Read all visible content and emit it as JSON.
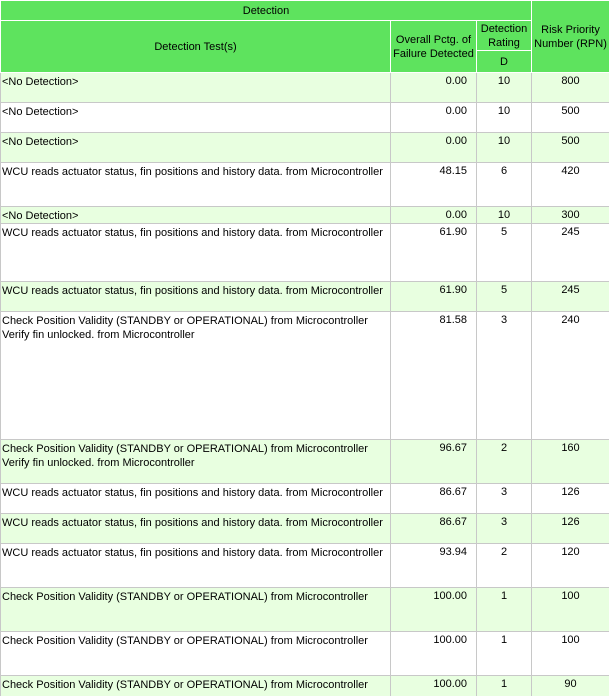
{
  "header": {
    "title": "Detection",
    "test_col": "Detection Test(s)",
    "pctg_col_line1": "Overall Pctg. of",
    "pctg_col_line2": "Failure Detected",
    "rating_col_line1": "Detection",
    "rating_col_line2": "Rating",
    "rating_sub": "D",
    "rpn_col_line1": "Risk Priority",
    "rpn_col_line2": "Number (RPN)"
  },
  "rows": [
    {
      "test": [
        "<No Detection>"
      ],
      "pctg": "0.00",
      "rating": "10",
      "rpn": "800"
    },
    {
      "test": [
        "<No Detection>"
      ],
      "pctg": "0.00",
      "rating": "10",
      "rpn": "500"
    },
    {
      "test": [
        "<No Detection>"
      ],
      "pctg": "0.00",
      "rating": "10",
      "rpn": "500"
    },
    {
      "test": [
        "WCU reads actuator status, fin positions and history data. from Microcontroller"
      ],
      "pctg": "48.15",
      "rating": "6",
      "rpn": "420"
    },
    {
      "test": [
        "<No Detection>"
      ],
      "pctg": "0.00",
      "rating": "10",
      "rpn": "300"
    },
    {
      "test": [
        "WCU reads actuator status, fin positions and history data. from Microcontroller"
      ],
      "pctg": "61.90",
      "rating": "5",
      "rpn": "245"
    },
    {
      "test": [
        "WCU reads actuator status, fin positions and history data. from Microcontroller"
      ],
      "pctg": "61.90",
      "rating": "5",
      "rpn": "245"
    },
    {
      "test": [
        "Check Position Validity (STANDBY or OPERATIONAL) from Microcontroller",
        "Verify fin unlocked. from Microcontroller"
      ],
      "pctg": "81.58",
      "rating": "3",
      "rpn": "240"
    },
    {
      "test": [
        "Check Position Validity (STANDBY or OPERATIONAL) from Microcontroller",
        "Verify fin unlocked. from Microcontroller"
      ],
      "pctg": "96.67",
      "rating": "2",
      "rpn": "160"
    },
    {
      "test": [
        "WCU reads actuator status, fin positions and history data. from Microcontroller"
      ],
      "pctg": "86.67",
      "rating": "3",
      "rpn": "126"
    },
    {
      "test": [
        "WCU reads actuator status, fin positions and history data. from Microcontroller"
      ],
      "pctg": "86.67",
      "rating": "3",
      "rpn": "126"
    },
    {
      "test": [
        "WCU reads actuator status, fin positions and history data. from Microcontroller"
      ],
      "pctg": "93.94",
      "rating": "2",
      "rpn": "120"
    },
    {
      "test": [
        "Check Position Validity (STANDBY or OPERATIONAL) from Microcontroller"
      ],
      "pctg": "100.00",
      "rating": "1",
      "rpn": "100"
    },
    {
      "test": [
        "Check Position Validity (STANDBY or OPERATIONAL) from Microcontroller"
      ],
      "pctg": "100.00",
      "rating": "1",
      "rpn": "100"
    },
    {
      "test": [
        "Check Position Validity (STANDBY or OPERATIONAL) from Microcontroller"
      ],
      "pctg": "100.00",
      "rating": "1",
      "rpn": "90"
    }
  ],
  "colors": {
    "header_green": "#5ee35e",
    "row_tint": "#e8ffe0",
    "row_white": "#ffffff",
    "grid": "#c8c8c8"
  }
}
